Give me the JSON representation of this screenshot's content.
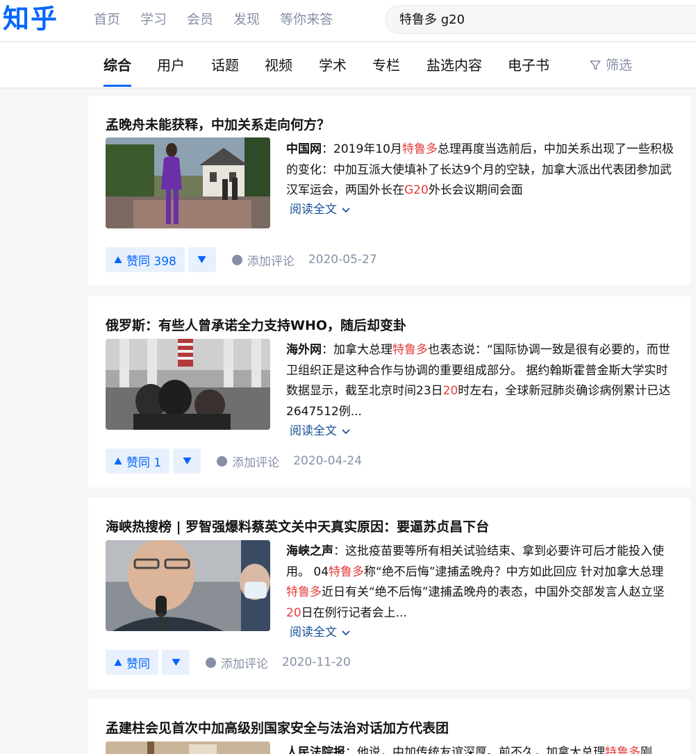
{
  "header": {
    "logo": "知乎",
    "nav": [
      "首页",
      "学习",
      "会员",
      "发现",
      "等你来答"
    ],
    "search_value": "特鲁多 g20"
  },
  "tabs": {
    "items": [
      "综合",
      "用户",
      "话题",
      "视频",
      "学术",
      "专栏",
      "盐选内容",
      "电子书"
    ],
    "filter_label": "筛选"
  },
  "colors": {
    "brand": "#0066ff",
    "highlight": "#e33d3d",
    "muted": "#8590a6",
    "link": "#175199"
  },
  "results": [
    {
      "title": "孟晚舟未能获释，中加关系走向何方？",
      "source": "中国网",
      "excerpt": [
        {
          "t": "：2019年10月"
        },
        {
          "t": "特鲁多",
          "hl": true
        },
        {
          "t": "总理再度当选前后，中加关系出现了一些积极的变化：中加互派大使填补了长达9个月的空缺，加拿大派出代表团参加武汉军运会，两国外长在"
        },
        {
          "t": "G20",
          "hl": true
        },
        {
          "t": "外长会议期间会面"
        }
      ],
      "read_more": "阅读全文",
      "vote_label": "赞同 398",
      "comment_label": "添加评论",
      "date": "2020-05-27"
    },
    {
      "title": "俄罗斯：有些人曾承诺全力支持WHO，随后却变卦",
      "source": "海外网",
      "excerpt": [
        {
          "t": "：加拿大总理"
        },
        {
          "t": "特鲁多",
          "hl": true
        },
        {
          "t": "也表态说：“国际协调一致是很有必要的，而世卫组织正是这种合作与协调的重要组成部分。 据约翰斯霍普金斯大学实时数据显示，截至北京时间23日"
        },
        {
          "t": "20",
          "hl": true
        },
        {
          "t": "时左右，全球新冠肺炎确诊病例累计已达2647512例..."
        }
      ],
      "read_more": "阅读全文",
      "vote_label": "赞同 1",
      "comment_label": "添加评论",
      "date": "2020-04-24"
    },
    {
      "title": "海峡热搜榜 | 罗智强爆料蔡英文关中天真实原因：要逼苏贞昌下台",
      "source": "海峡之声",
      "excerpt": [
        {
          "t": "：这批疫苗要等所有相关试验结束、拿到必要许可后才能投入使用。 04"
        },
        {
          "t": "特鲁多",
          "hl": true
        },
        {
          "t": "称“绝不后悔”逮捕孟晚舟？中方如此回应 针对加拿大总理"
        },
        {
          "t": "特鲁多",
          "hl": true
        },
        {
          "t": "近日有关“绝不后悔”逮捕孟晚舟的表态，中国外交部发言人赵立坚"
        },
        {
          "t": "20",
          "hl": true
        },
        {
          "t": "日在例行记者会上..."
        }
      ],
      "read_more": "阅读全文",
      "vote_label": "赞同",
      "comment_label": "添加评论",
      "date": "2020-11-20"
    },
    {
      "title": "孟建柱会见首次中加高级别国家安全与法治对话加方代表团",
      "source": "人民法院报",
      "excerpt": [
        {
          "t": "：他说，中加传统友谊深厚。前不久，加拿大总理"
        },
        {
          "t": "特鲁多",
          "hl": true
        },
        {
          "t": "刚"
        }
      ],
      "read_more": "",
      "vote_label": "",
      "comment_label": "",
      "date": ""
    }
  ]
}
